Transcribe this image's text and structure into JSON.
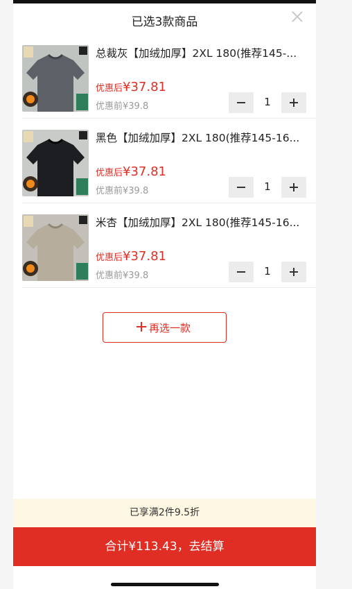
{
  "header": {
    "title": "已选3款商品"
  },
  "items": [
    {
      "name": "总裁灰【加绒加厚】2XL 180(推荐145-...",
      "after_label": "优惠后",
      "after_price": "¥37.81",
      "before_label": "优惠前",
      "before_price": "¥39.8",
      "qty": "1",
      "color": "#5b6167"
    },
    {
      "name": "黑色【加绒加厚】2XL 180(推荐145-16...",
      "after_label": "优惠后",
      "after_price": "¥37.81",
      "before_label": "优惠前",
      "before_price": "¥39.8",
      "qty": "1",
      "color": "#1d1e21"
    },
    {
      "name": "米杏【加绒加厚】2XL 180(推荐145-16...",
      "after_label": "优惠后",
      "after_price": "¥37.81",
      "before_label": "优惠前",
      "before_price": "¥39.8",
      "qty": "1",
      "color": "#b6ad9d"
    }
  ],
  "add_button": {
    "label": "再选一款"
  },
  "promo": {
    "text": "已享满2件9.5折"
  },
  "checkout": {
    "label": "合计¥113.43，去结算"
  },
  "colors": {
    "accent": "#e02e24",
    "promo_bg": "#fdf7e3"
  }
}
